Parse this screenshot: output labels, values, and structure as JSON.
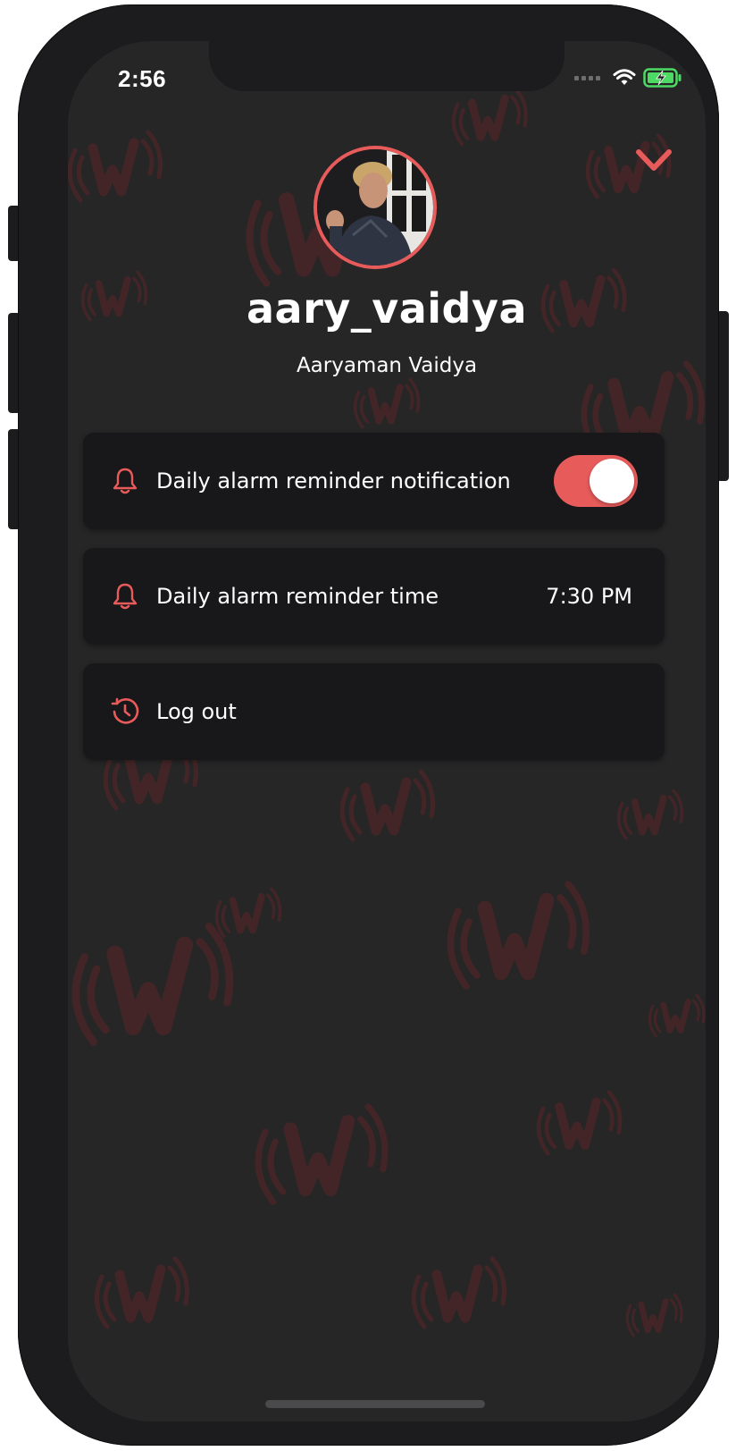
{
  "status_bar": {
    "time": "2:56",
    "signal_icon": "signal-dots-icon",
    "wifi_icon": "wifi-icon",
    "battery_icon": "battery-charging-icon",
    "battery_color": "#4cd964"
  },
  "header": {
    "close_icon": "chevron-down-icon",
    "avatar_icon": "profile-photo",
    "username": "aary_vaidya",
    "full_name": "Aaryaman Vaidya"
  },
  "settings": {
    "items": [
      {
        "icon": "bell-icon",
        "label": "Daily alarm reminder notification",
        "control": "toggle",
        "toggle_on": true
      },
      {
        "icon": "bell-icon",
        "label": "Daily alarm reminder time",
        "value": "7:30 PM"
      },
      {
        "icon": "logout-icon",
        "label": "Log out"
      }
    ]
  },
  "theme": {
    "accent": "#e85b5b",
    "background": "#262627",
    "card": "#18171a",
    "text": "#ffffff"
  }
}
